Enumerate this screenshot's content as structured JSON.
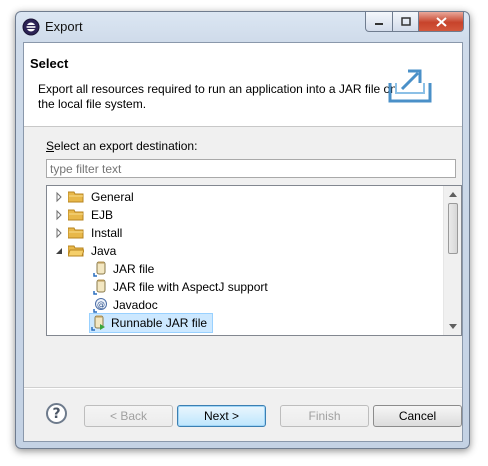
{
  "window": {
    "title": "Export"
  },
  "banner": {
    "title": "Select",
    "description": "Export all resources required to run an application into a JAR file on the local file system."
  },
  "destination": {
    "label": "Select an export destination:",
    "filter_placeholder": "type filter text"
  },
  "tree": {
    "items": [
      {
        "label": "General",
        "type": "folder",
        "expanded": false
      },
      {
        "label": "EJB",
        "type": "folder",
        "expanded": false
      },
      {
        "label": "Install",
        "type": "folder",
        "expanded": false
      },
      {
        "label": "Java",
        "type": "folder",
        "expanded": true
      },
      {
        "label": "JAR file",
        "type": "jar"
      },
      {
        "label": "JAR file with AspectJ support",
        "type": "jar"
      },
      {
        "label": "Javadoc",
        "type": "javadoc"
      },
      {
        "label": "Runnable JAR file",
        "type": "runnable-jar",
        "selected": true
      }
    ]
  },
  "buttons": {
    "help": "?",
    "back": "< Back",
    "next": "Next >",
    "finish": "Finish",
    "cancel": "Cancel"
  },
  "colors": {
    "selection": "#cce8ff",
    "close_button": "#c7432b",
    "folder": "#e8b84a"
  }
}
